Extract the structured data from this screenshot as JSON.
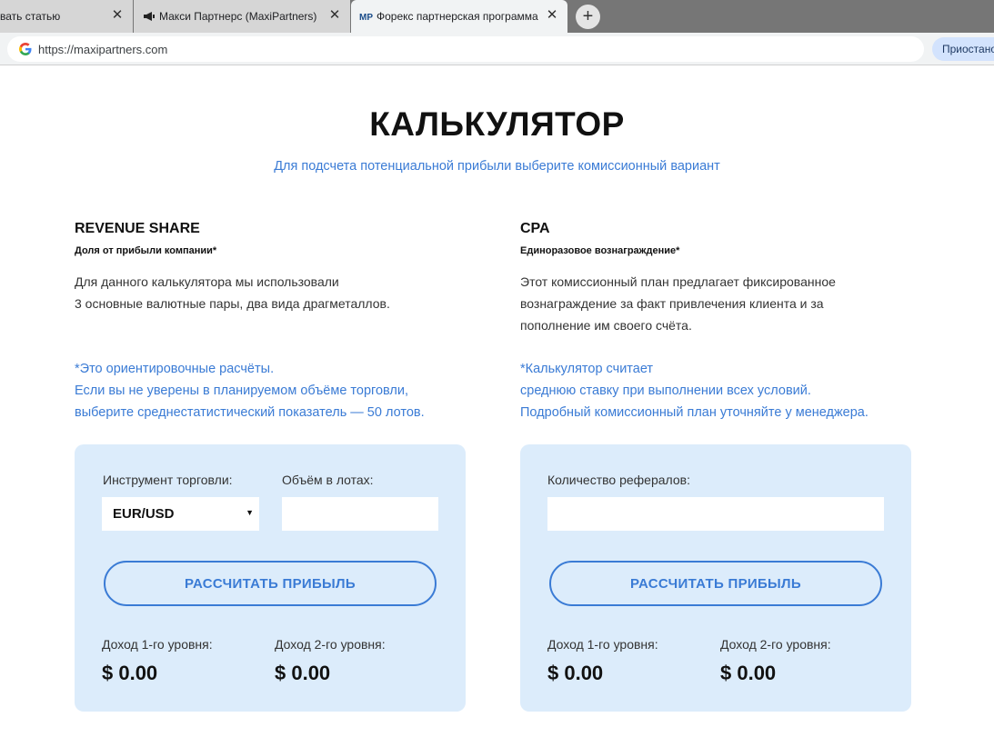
{
  "browser": {
    "tabs": [
      {
        "label": "вать статью",
        "active": false
      },
      {
        "label": "Макси Партнерс (MaxiPartners)",
        "active": false
      },
      {
        "label": "Форекс партнерская программа",
        "active": true
      }
    ],
    "url": "https://maxipartners.com",
    "pause_label": "Приостановлено"
  },
  "page": {
    "title": "КАЛЬКУЛЯТОР",
    "subtitle": "Для подсчета потенциальной прибыли выберите комиссионный вариант",
    "revenue": {
      "heading": "REVENUE SHARE",
      "subheading": "Доля от прибыли компании*",
      "desc_lines": [
        "Для данного калькулятора мы использовали",
        "3 основные валютные пары, два вида драгметаллов."
      ],
      "note_lines": [
        "*Это ориентировочные расчёты.",
        "Если вы не уверены в планируемом объёме торговли,",
        "выберите среднестатистический показатель — 50 лотов."
      ],
      "instrument_label": "Инструмент торговли:",
      "instrument_value": "EUR/USD",
      "volume_label": "Объём в лотах:",
      "volume_value": "",
      "button": "РАССЧИТАТЬ ПРИБЫЛЬ",
      "level1_label": "Доход 1-го уровня:",
      "level1_value": "$ 0.00",
      "level2_label": "Доход 2-го уровня:",
      "level2_value": "$ 0.00"
    },
    "cpa": {
      "heading": "CPA",
      "subheading": "Единоразовое вознаграждение*",
      "desc_lines": [
        "Этот комиссионный план предлагает фиксированное",
        "вознаграждение за факт привлечения клиента и за",
        "пополнение им своего счёта."
      ],
      "note_lines": [
        "*Калькулятор считает",
        "среднюю ставку при выполнении всех условий.",
        "Подробный комиссионный план уточняйте у менеджера."
      ],
      "referrals_label": "Количество рефералов:",
      "referrals_value": "",
      "button": "РАССЧИТАТЬ ПРИБЫЛЬ",
      "level1_label": "Доход 1-го уровня:",
      "level1_value": "$ 0.00",
      "level2_label": "Доход 2-го уровня:",
      "level2_value": "$ 0.00"
    }
  },
  "colors": {
    "accent": "#3a7bd5",
    "card_bg": "#dcecfb"
  },
  "icons": {
    "tab2": "megaphone-icon",
    "tab3": "mp-logo-icon",
    "omnibox": "google-icon"
  }
}
